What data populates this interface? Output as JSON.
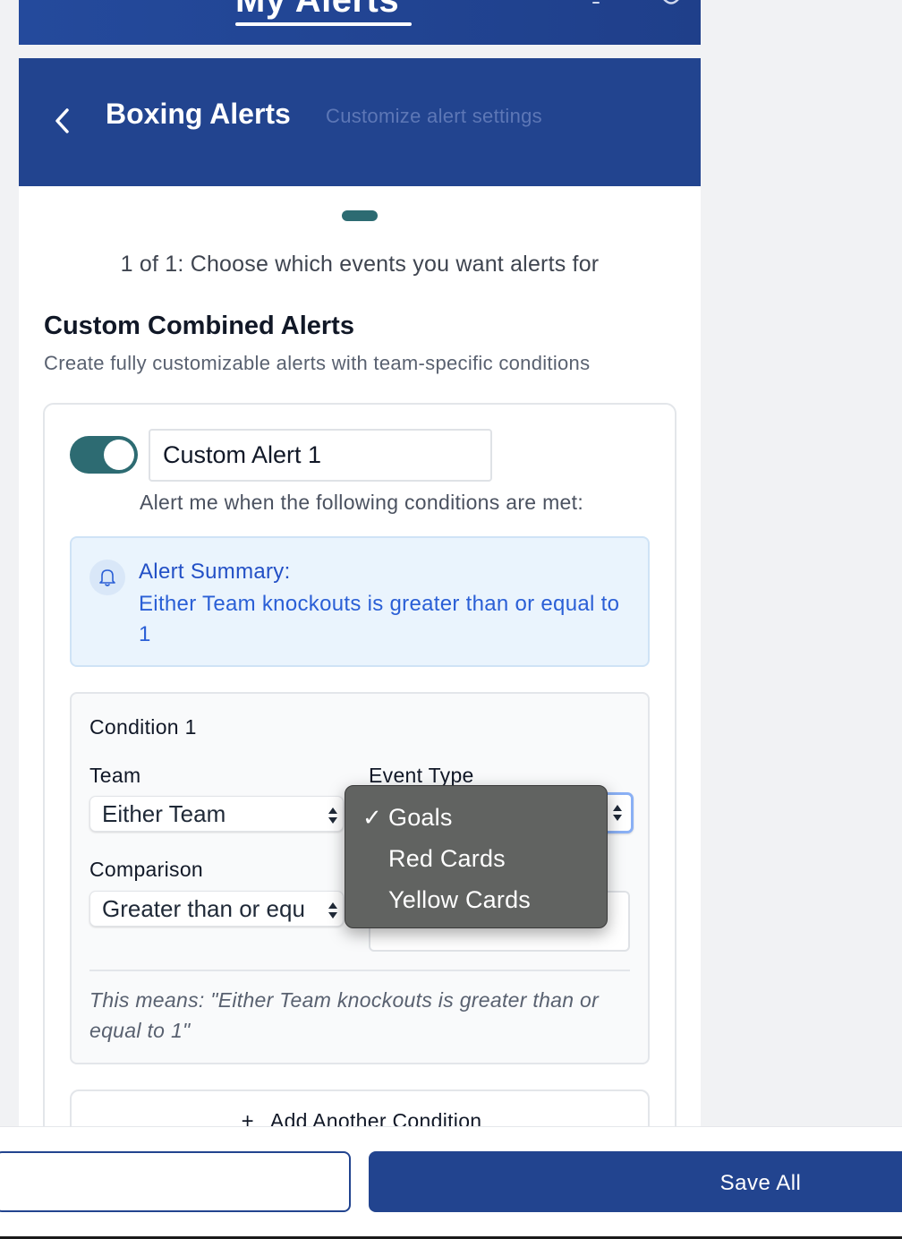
{
  "app_header": {
    "title": "My Alerts"
  },
  "panel_header": {
    "title": "Boxing Alerts",
    "subtitle": "Customize alert settings"
  },
  "step": {
    "text": "1 of 1: Choose which events you want alerts for"
  },
  "section": {
    "title": "Custom Combined Alerts",
    "description": "Create fully customizable alerts with team-specific conditions"
  },
  "alert": {
    "enabled": true,
    "name_value": "Custom Alert 1",
    "intro": "Alert me when the following conditions are met:",
    "summary_title": "Alert Summary:",
    "summary_text": "Either Team knockouts is greater than or equal to 1"
  },
  "condition": {
    "title": "Condition 1",
    "team_label": "Team",
    "team_value": "Either Team",
    "event_type_label": "Event Type",
    "comparison_label": "Comparison",
    "comparison_value": "Greater than or equ",
    "means_text": "This means: \"Either Team knockouts is greater than or equal to 1\""
  },
  "add_condition": {
    "plus": "+",
    "label": "Add Another Condition"
  },
  "event_type_menu": {
    "check": "✓",
    "options": [
      "Goals",
      "Red Cards",
      "Yellow Cards"
    ],
    "selected": "Goals"
  },
  "bottom_bar": {
    "save_label": "Save All"
  },
  "colors": {
    "brand_blue": "#22448f",
    "teal": "#2d6b72",
    "summary_blue": "#2a5fd6",
    "summary_bg": "#eaf4fd"
  }
}
